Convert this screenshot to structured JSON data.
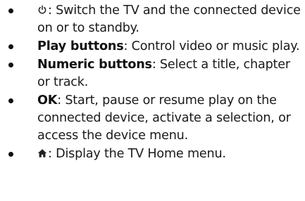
{
  "items": [
    {
      "icon": "power-standby-icon",
      "desc": ": Switch the TV and the connected device on or to standby."
    },
    {
      "term": "Play buttons",
      "desc": ": Control video or music play."
    },
    {
      "term": "Numeric buttons",
      "desc": ": Select a title, chapter or track."
    },
    {
      "term": "OK",
      "desc": ": Start, pause or resume play on the connected device, activate a selection, or access the device menu."
    },
    {
      "icon": "home-icon",
      "desc": ": Display the TV Home menu."
    }
  ]
}
